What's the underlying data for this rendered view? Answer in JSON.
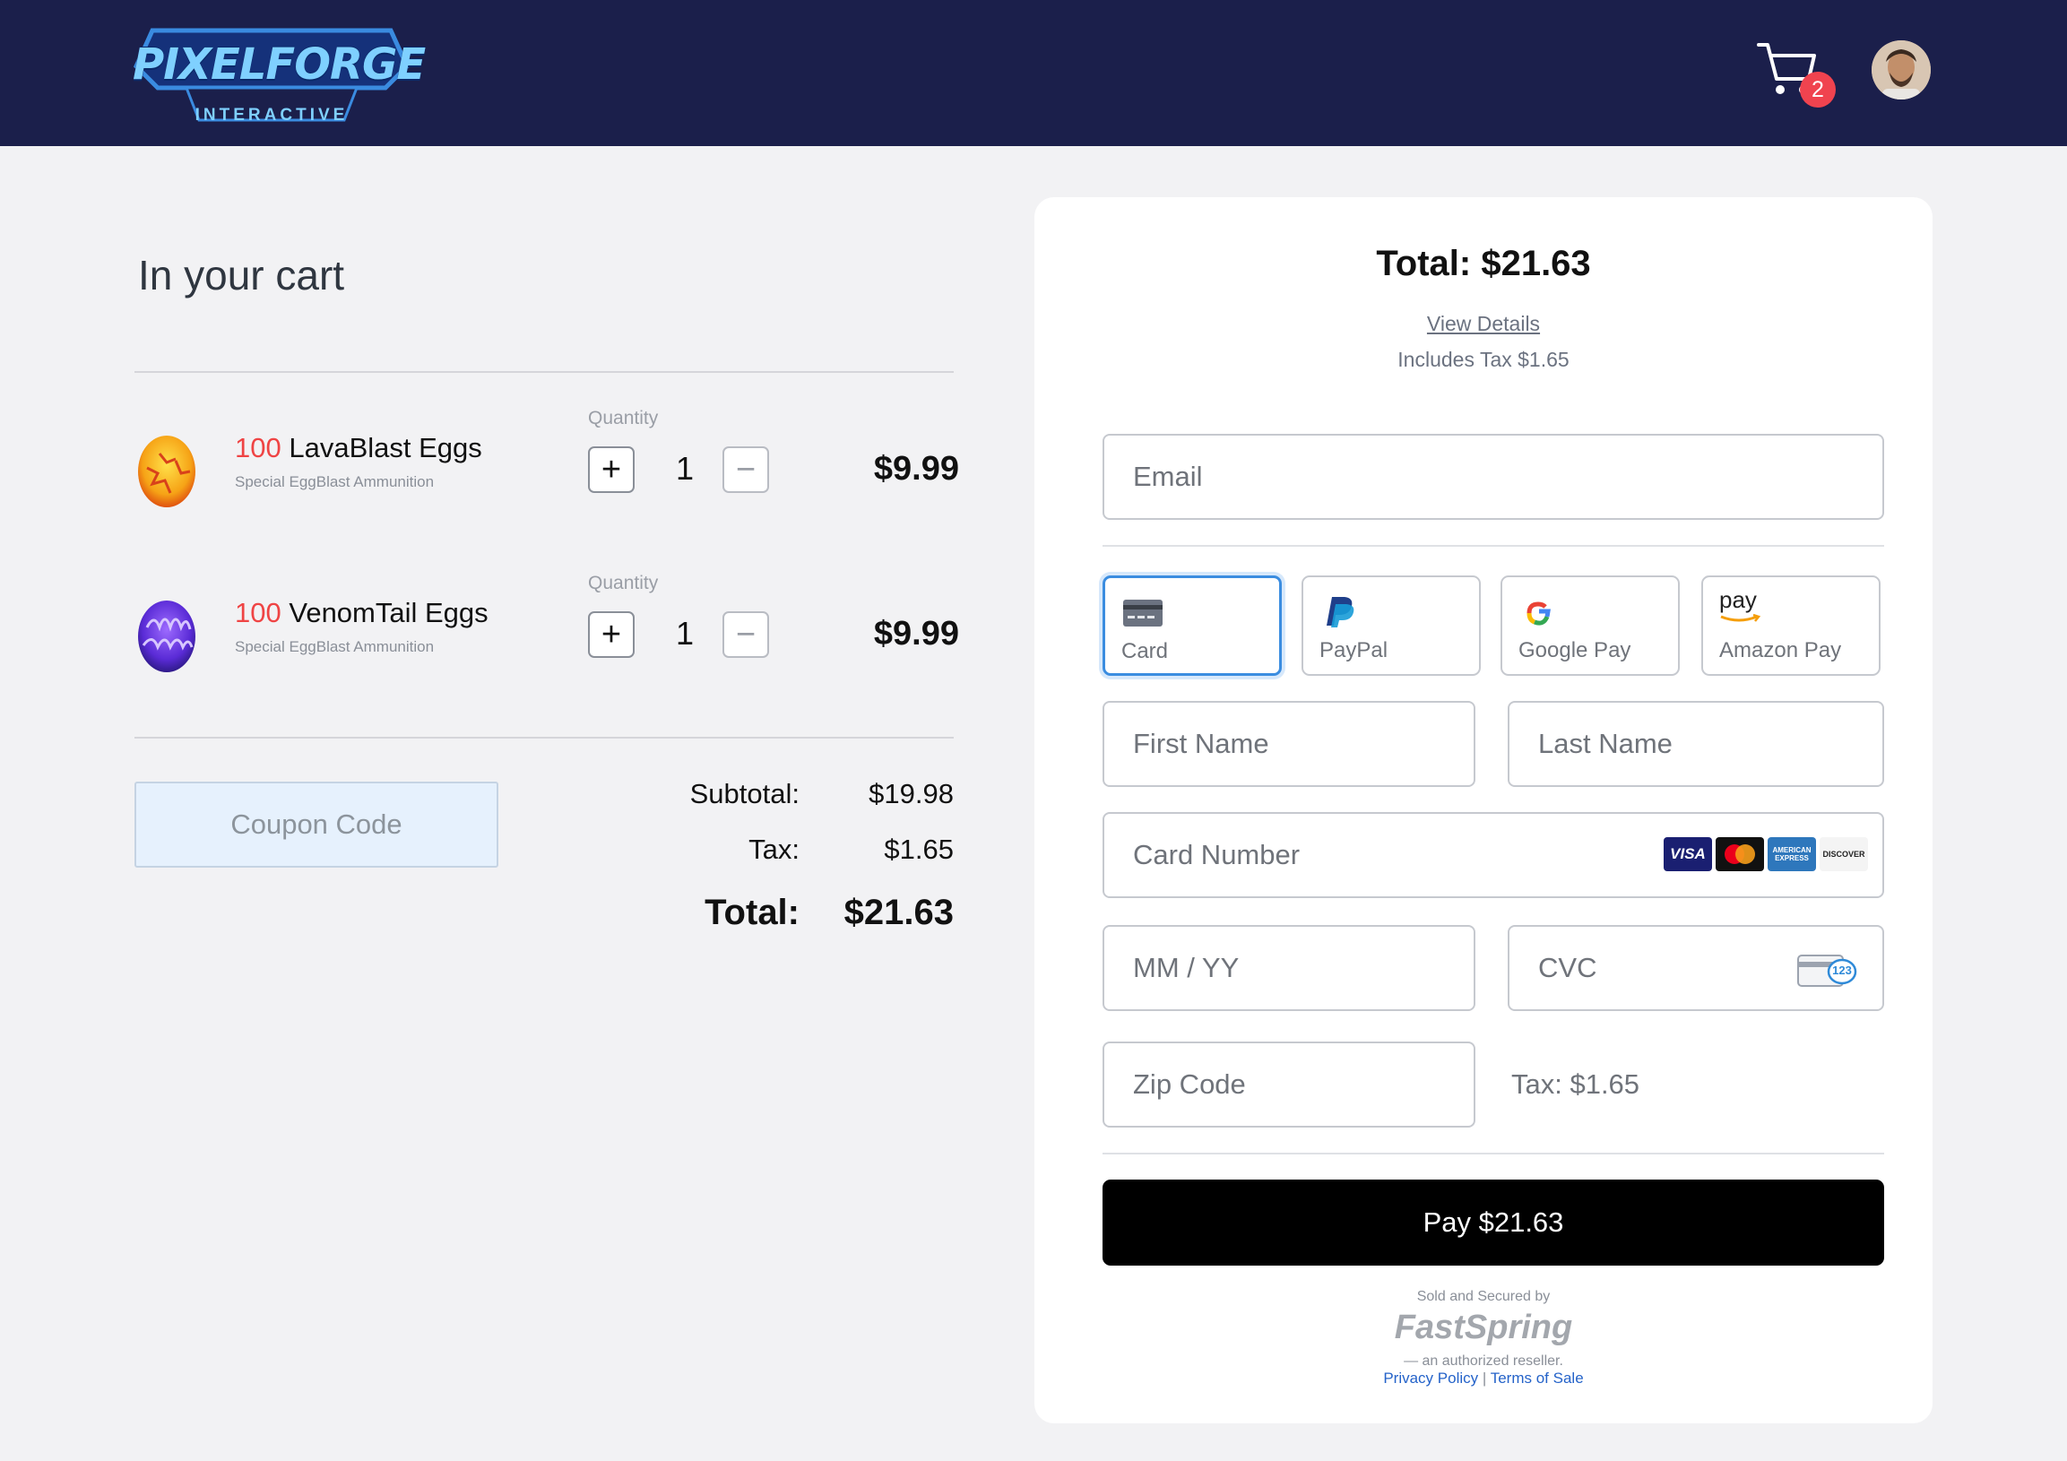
{
  "header": {
    "logo_title": "PIXELFORGE",
    "logo_subtitle": "INTERACTIVE",
    "cart_count": "2"
  },
  "cart": {
    "heading": "In your cart",
    "items": [
      {
        "qty_prefix": "100",
        "name": "LavaBlast Eggs",
        "subtitle": "Special EggBlast Ammunition",
        "quantity_label": "Quantity",
        "quantity": "1",
        "price": "$9.99",
        "plus": "+",
        "minus": "−"
      },
      {
        "qty_prefix": "100",
        "name": "VenomTail Eggs",
        "subtitle": "Special EggBlast Ammunition",
        "quantity_label": "Quantity",
        "quantity": "1",
        "price": "$9.99",
        "plus": "+",
        "minus": "−"
      }
    ],
    "coupon_placeholder": "Coupon Code",
    "summary": {
      "subtotal_label": "Subtotal:",
      "subtotal": "$19.98",
      "tax_label": "Tax:",
      "tax": "$1.65",
      "total_label": "Total:",
      "total": "$21.63"
    }
  },
  "checkout": {
    "total": "Total: $21.63",
    "view_details": "View Details",
    "includes_tax": "Includes Tax $1.65",
    "email_placeholder": "Email",
    "payment_methods": [
      {
        "label": "Card",
        "icon": "credit-card-icon",
        "active": true
      },
      {
        "label": "PayPal",
        "icon": "paypal-icon",
        "active": false
      },
      {
        "label": "Google Pay",
        "icon": "google-icon",
        "active": false
      },
      {
        "label": "Amazon Pay",
        "icon": "amazon-pay-icon",
        "active": false
      }
    ],
    "amazon_pay_mark": "pay",
    "first_name_placeholder": "First Name",
    "last_name_placeholder": "Last Name",
    "card_number_placeholder": "Card Number",
    "card_brands": [
      "VISA",
      "mastercard",
      "AMERICAN EXPRESS",
      "DISCOVER"
    ],
    "expiry_placeholder": "MM / YY",
    "cvc_placeholder": "CVC",
    "cvc_hint": "123",
    "zip_placeholder": "Zip Code",
    "tax_note": "Tax: $1.65",
    "pay_button": "Pay $21.63",
    "sold_by": "Sold and Secured by",
    "reseller_logo": "FastSpring",
    "reseller_note": "— an authorized reseller.",
    "privacy_link": "Privacy Policy",
    "legal_separator": "|",
    "terms_link": "Terms of Sale"
  },
  "colors": {
    "header_bg": "#1b1f4b",
    "accent_red": "#ef4444",
    "active_tab_border": "#3b8de0",
    "pay_button_bg": "#000000",
    "link_blue": "#2563c9"
  }
}
